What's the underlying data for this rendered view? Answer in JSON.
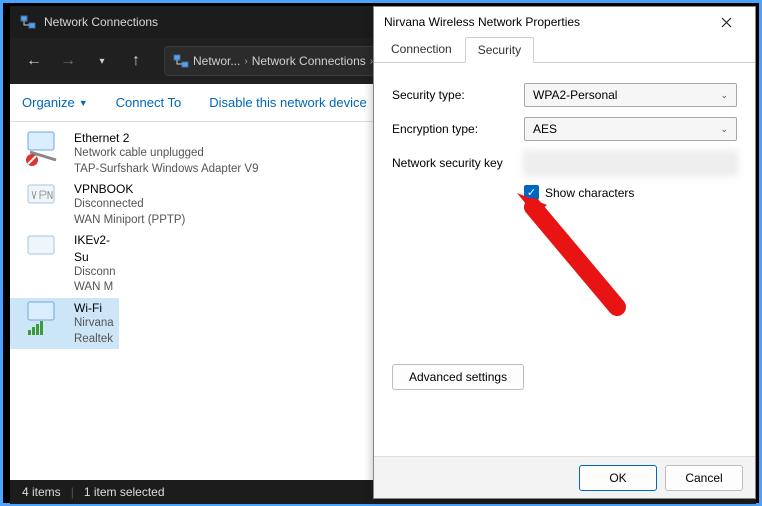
{
  "explorer": {
    "title": "Network Connections",
    "breadcrumb": {
      "c1": "Networ...",
      "c2": "Network Connections"
    },
    "commands": {
      "organize": "Organize",
      "connect": "Connect To",
      "disable": "Disable this network device"
    },
    "items": [
      {
        "name": "Ethernet 2",
        "status": "Network cable unplugged",
        "adapter": "TAP-Surfshark Windows Adapter V9",
        "selected": false,
        "col": 1
      },
      {
        "name": "VPNBOOK",
        "status": "Disconnected",
        "adapter": "WAN Miniport (PPTP)",
        "selected": false,
        "col": 1
      },
      {
        "name": "IKEv2-Su",
        "status": "Disconn",
        "adapter": "WAN M",
        "selected": false,
        "col": 2
      },
      {
        "name": "Wi-Fi",
        "status": "Nirvana",
        "adapter": "Realtek",
        "selected": true,
        "col": 2
      }
    ],
    "status": {
      "count": "4 items",
      "selected": "1 item selected"
    }
  },
  "dialog": {
    "title": "Nirvana Wireless Network Properties",
    "tabs": {
      "t1": "Connection",
      "t2": "Security"
    },
    "fields": {
      "security_type_label": "Security type:",
      "security_type_value": "WPA2-Personal",
      "encryption_type_label": "Encryption type:",
      "encryption_type_value": "AES",
      "key_label": "Network security key",
      "show_chars": "Show characters"
    },
    "advanced": "Advanced settings",
    "ok": "OK",
    "cancel": "Cancel"
  }
}
